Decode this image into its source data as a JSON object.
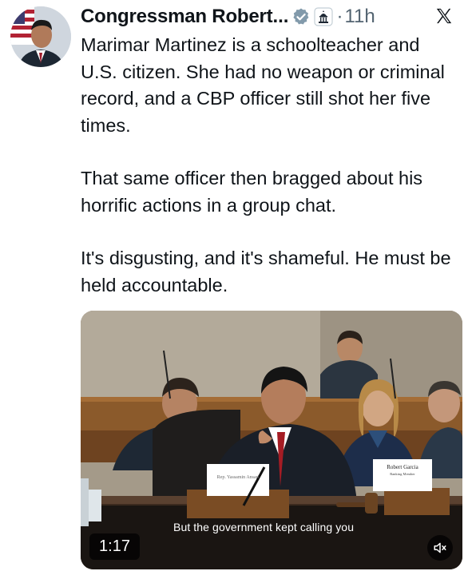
{
  "tweet": {
    "author": {
      "name": "Congressman Robert",
      "name_truncation": "...",
      "avatar_icon": "profile-photo-avatar",
      "verified_icon": "verified-badge-icon",
      "affiliation_icon": "capitol-building-icon"
    },
    "separator": "·",
    "timestamp": "11h",
    "platform_icon": "x-logo-icon",
    "paragraphs": [
      "Marimar Martinez is a schoolteacher and U.S. citizen. She had no weapon or criminal record, and a CBP officer still shot her five times.",
      "That same officer then bragged about his horrific actions in a group chat.",
      "It's disgusting, and it's shameful. He must be held accountable."
    ],
    "media": {
      "type": "video",
      "caption": "But the government kept calling you",
      "duration": "1:17",
      "mute_icon": "speaker-muted-icon",
      "placard_left": "Rep. Yassamin Ansari",
      "placard_right_name": "Robert Garcia",
      "placard_right_title": "Ranking Member"
    },
    "colors": {
      "text": "#0f1419",
      "secondary": "#536471",
      "verified": "#829aab"
    }
  }
}
